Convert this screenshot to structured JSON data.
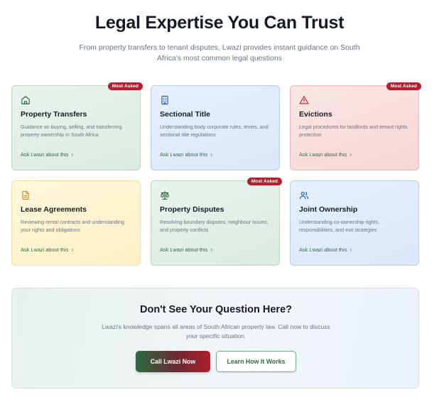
{
  "header": {
    "title": "Legal Expertise You Can Trust",
    "subtitle": "From property transfers to tenant disputes, Lwazi provides instant guidance on South Africa's most common legal questions"
  },
  "cards": [
    {
      "title": "Property Transfers",
      "description": "Guidance on buying, selling, and transferring property ownership in South Africa",
      "link": "Ask Lwazi about this",
      "badge": "Most Asked",
      "icon": "home-icon",
      "theme": "green"
    },
    {
      "title": "Sectional Title",
      "description": "Understanding body corporate rules, levies, and sectional title regulations",
      "link": "Ask Lwazi about this",
      "badge": "",
      "icon": "building-icon",
      "theme": "blue"
    },
    {
      "title": "Evictions",
      "description": "Legal procedures for landlords and tenant rights protection",
      "link": "Ask Lwazi about this",
      "badge": "Most Asked",
      "icon": "alert-triangle-icon",
      "theme": "red"
    },
    {
      "title": "Lease Agreements",
      "description": "Reviewing rental contracts and understanding your rights and obligations",
      "link": "Ask Lwazi about this",
      "badge": "",
      "icon": "document-icon",
      "theme": "yellow"
    },
    {
      "title": "Property Disputes",
      "description": "Resolving boundary disputes, neighbour issues, and property conflicts",
      "link": "Ask Lwazi about this",
      "badge": "Most Asked",
      "icon": "scales-icon",
      "theme": "green"
    },
    {
      "title": "Joint Ownership",
      "description": "Understanding co-ownership rights, responsibilities, and exit strategies",
      "link": "Ask Lwazi about this",
      "badge": "",
      "icon": "users-icon",
      "theme": "blue"
    }
  ],
  "cta": {
    "title": "Don't See Your Question Here?",
    "text": "Lwazi's knowledge spans all areas of South African property law. Call now to discuss your specific situation.",
    "primary_button": "Call Lwazi Now",
    "secondary_button": "Learn How It Works"
  },
  "colors": {
    "brand_green": "#2f6b46",
    "brand_red": "#b1202e",
    "icon_green": "#2f6b46",
    "icon_blue": "#2a5fc1",
    "icon_red": "#c0262f",
    "icon_yellow": "#e08a1e"
  }
}
